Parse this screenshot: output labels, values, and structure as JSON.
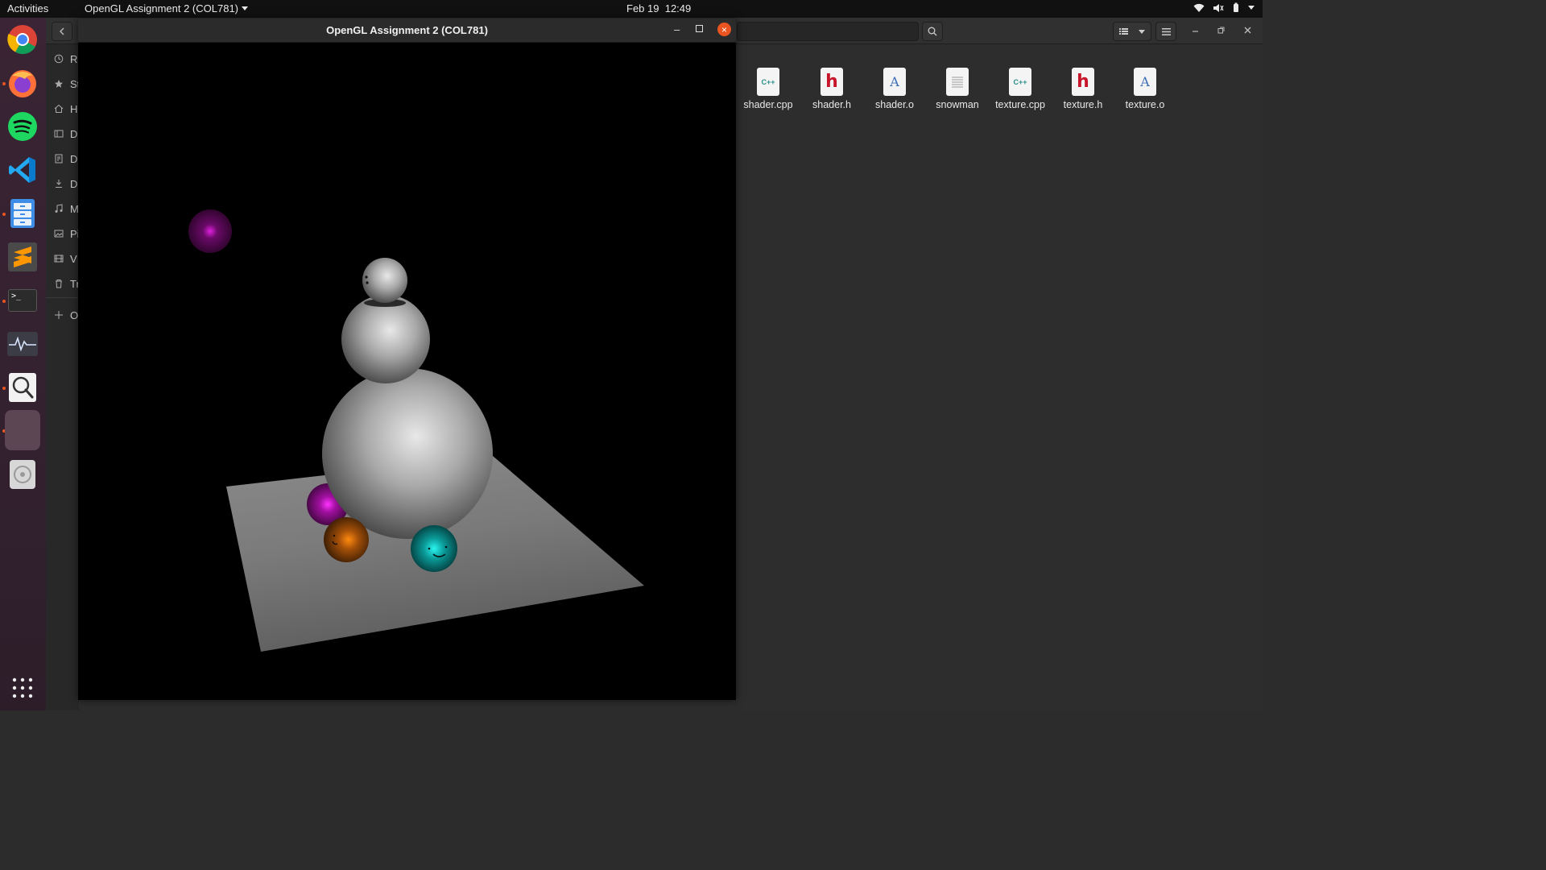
{
  "topbar": {
    "activities": "Activities",
    "app_name": "OpenGL Assignment 2 (COL781)",
    "date": "Feb 19",
    "time": "12:49"
  },
  "dock": {
    "apps": [
      "chrome-icon",
      "firefox-icon",
      "spotify-icon",
      "vscode-icon",
      "files-icon",
      "sublime-text-icon",
      "terminal-icon",
      "system-monitor-icon",
      "image-viewer-icon",
      "opengl-app-icon",
      "disc-icon",
      "app-grid-icon"
    ],
    "terminal_glyph": ">_"
  },
  "files_window": {
    "sidebar": [
      "R",
      "St",
      "H",
      "D",
      "D",
      "D",
      "M",
      "Pi",
      "V",
      "Tr",
      "O"
    ],
    "items": [
      {
        "name": "shader.cpp",
        "badge": "C++"
      },
      {
        "name": "shader.h",
        "badge": "h"
      },
      {
        "name": "shader.o",
        "badge": "A"
      },
      {
        "name": "snowman",
        "badge": ""
      },
      {
        "name": "texture.cpp",
        "badge": "C++"
      },
      {
        "name": "texture.h",
        "badge": "h"
      },
      {
        "name": "texture.o",
        "badge": "A"
      }
    ]
  },
  "gl_window": {
    "title": "OpenGL Assignment 2 (COL781)",
    "minimize": "–",
    "close": "×"
  },
  "colors": {
    "accent": "#e95420",
    "dock_bg": "#33212f",
    "header_red": "#c7162b",
    "cpp_teal": "#2a8f8a"
  }
}
